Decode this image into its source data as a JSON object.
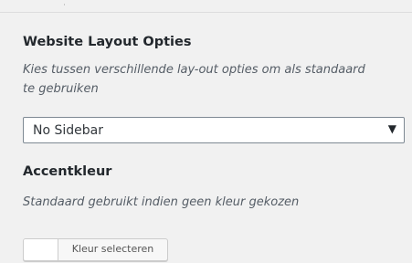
{
  "layout_section": {
    "title": "Website Layout Opties",
    "description_line1": "Kies tussen verschillende lay-out opties om als standaard",
    "description_line2": "te gebruiken",
    "select": {
      "selected_value": "No Sidebar",
      "arrow": "▼"
    }
  },
  "accent_section": {
    "title": "Accentkleur",
    "description": "Standaard gebruikt indien geen kleur gekozen",
    "color_button_label": "Kleur selecteren",
    "current_color": "#ffffff"
  },
  "colors": {
    "background": "#f1f1f1",
    "select_border": "#7e8993",
    "text": "#23282d"
  }
}
